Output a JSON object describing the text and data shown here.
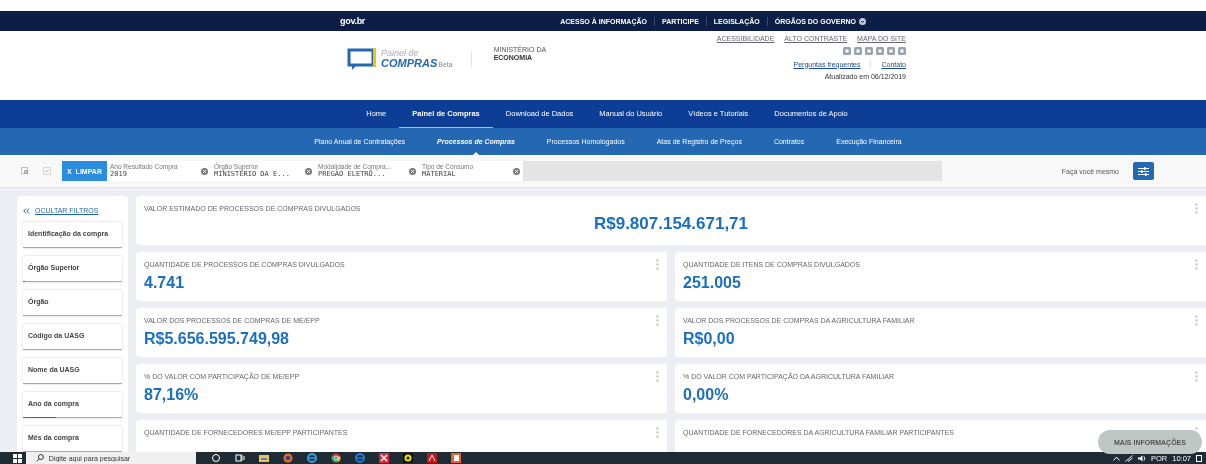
{
  "gov_bar": {
    "logo": "gov.br",
    "links": [
      "ACESSO À INFORMAÇÃO",
      "PARTICIPE",
      "LEGISLAÇÃO",
      "ÓRGÃOS DO GOVERNO"
    ]
  },
  "header": {
    "brand_top": "Painel de",
    "brand_main": "COMPRAS",
    "brand_tag": "Beta",
    "ministry_line1": "MINISTÉRIO DA",
    "ministry_line2": "ECONOMIA",
    "utility_links": [
      "ACESSIBILIDADE",
      "ALTO CONTRASTE",
      "MAPA DO SITE"
    ],
    "help_links": [
      "Perguntas frequentes",
      "Contato"
    ],
    "updated": "Atualizado em 06/12/2019"
  },
  "main_nav": [
    {
      "label": "Home",
      "selected": false
    },
    {
      "label": "Painel de Compras",
      "selected": true
    },
    {
      "label": "Download de Dados",
      "selected": false
    },
    {
      "label": "Manual do Usuário",
      "selected": false
    },
    {
      "label": "Vídeos e Tutoriais",
      "selected": false
    },
    {
      "label": "Documentos de Apoio",
      "selected": false
    }
  ],
  "sub_nav": [
    {
      "label": "Plano Anual de Contratações",
      "selected": false
    },
    {
      "label": "Processos de Compras",
      "selected": true
    },
    {
      "label": "Processos Homologados",
      "selected": false
    },
    {
      "label": "Atas de Registro de Preços",
      "selected": false
    },
    {
      "label": "Contratos",
      "selected": false
    },
    {
      "label": "Execução Financeira",
      "selected": false
    }
  ],
  "filter_bar": {
    "clear_button": "X  LIMPAR",
    "selections": [
      {
        "field": "Ano Resultado Compra",
        "value": "2019"
      },
      {
        "field": "Órgão Superior",
        "value": "MINISTÉRIO DA E..."
      },
      {
        "field": "Modalidade de Compra...",
        "value": "PREGÃO ELETRÔ..."
      },
      {
        "field": "Tipo de Consumo",
        "value": "MATERIAL"
      }
    ],
    "self_service_label": "Faça você mesmo"
  },
  "sidebar": {
    "hide_link": "OCULTAR FILTROS",
    "filters": [
      {
        "label": "Identificação da compra",
        "level": 0
      },
      {
        "label": "Órgão Superior",
        "level": 0.02
      },
      {
        "label": "Órgão",
        "level": 0
      },
      {
        "label": "Código da UASG",
        "level": 0
      },
      {
        "label": "Nome da UASG",
        "level": 0
      },
      {
        "label": "Ano da compra",
        "level": 0.33
      },
      {
        "label": "Mês da compra",
        "level": 0
      }
    ]
  },
  "kpi_cards": [
    {
      "title": "VALOR ESTIMADO DE PROCESSOS DE COMPRAS DIVULGADOS",
      "value": "R$9.807.154.671,71",
      "kind": "wide"
    },
    {
      "title": "QUANTIDADE DE PROCESSOS DE COMPRAS DIVULGADOS",
      "value": "4.741",
      "kind": "half"
    },
    {
      "title": "QUANTIDADE DE ITENS DE COMPRAS DIVULGADOS",
      "value": "251.005",
      "kind": "half"
    },
    {
      "title": "VALOR DOS PROCESSOS DE COMPRAS DE ME/EPP",
      "value": "R$5.656.595.749,98",
      "kind": "half"
    },
    {
      "title": "VALOR DOS PROCESSOS DE COMPRAS DA AGRICULTURA FAMILIAR",
      "value": "R$0,00",
      "kind": "half"
    },
    {
      "title": "% DO VALOR COM PARTICIPAÇÃO DE ME/EPP",
      "value": "87,16%",
      "kind": "half"
    },
    {
      "title": "% DO VALOR COM PARTICIPAÇÃO DA AGRICULTURA FAMILIAR",
      "value": "0,00%",
      "kind": "half"
    },
    {
      "title": "QUANTIDADE DE FORNECEDORES ME/EPP PARTICIPANTES",
      "kind": "half"
    },
    {
      "title": "QUANTIDADE DE FORNECEDORES DA AGRICULTURA FAMILIAR PARTICIPANTES",
      "kind": "half"
    }
  ],
  "more_info_button": "MAIS INFORMAÇÕES",
  "taskbar": {
    "search_placeholder": "Digite aqui para pesquisar",
    "language": "POR",
    "time": "10:07"
  }
}
